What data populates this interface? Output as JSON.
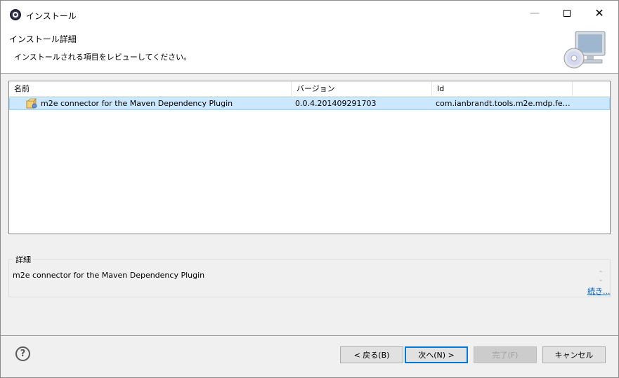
{
  "window": {
    "title": "インストール",
    "icon": "eclipse-icon",
    "controls": {
      "minimize": "—",
      "close": "✕"
    }
  },
  "header": {
    "title": "インストール詳細",
    "description": "インストールされる項目をレビューしてください。",
    "icon": "monitor-cd-icon"
  },
  "table": {
    "columns": [
      "名前",
      "バージョン",
      "Id"
    ],
    "rows": [
      {
        "icon": "feature-plugin-icon",
        "name": "m2e connector for the Maven Dependency Plugin",
        "version": "0.0.4.201409291703",
        "id": "com.ianbrandt.tools.m2e.mdp.feat..."
      }
    ]
  },
  "details": {
    "label": "詳細",
    "text": "m2e connector for the Maven Dependency Plugin",
    "more_link": "続き..."
  },
  "footer": {
    "help_icon": "?",
    "back_label": "< 戻る(B)",
    "next_label": "次へ(N) >",
    "finish_label": "完了(F)",
    "cancel_label": "キャンセル"
  },
  "colors": {
    "selection": "#cce8ff",
    "default_button_border": "#0078d7",
    "link": "#0066cc"
  }
}
